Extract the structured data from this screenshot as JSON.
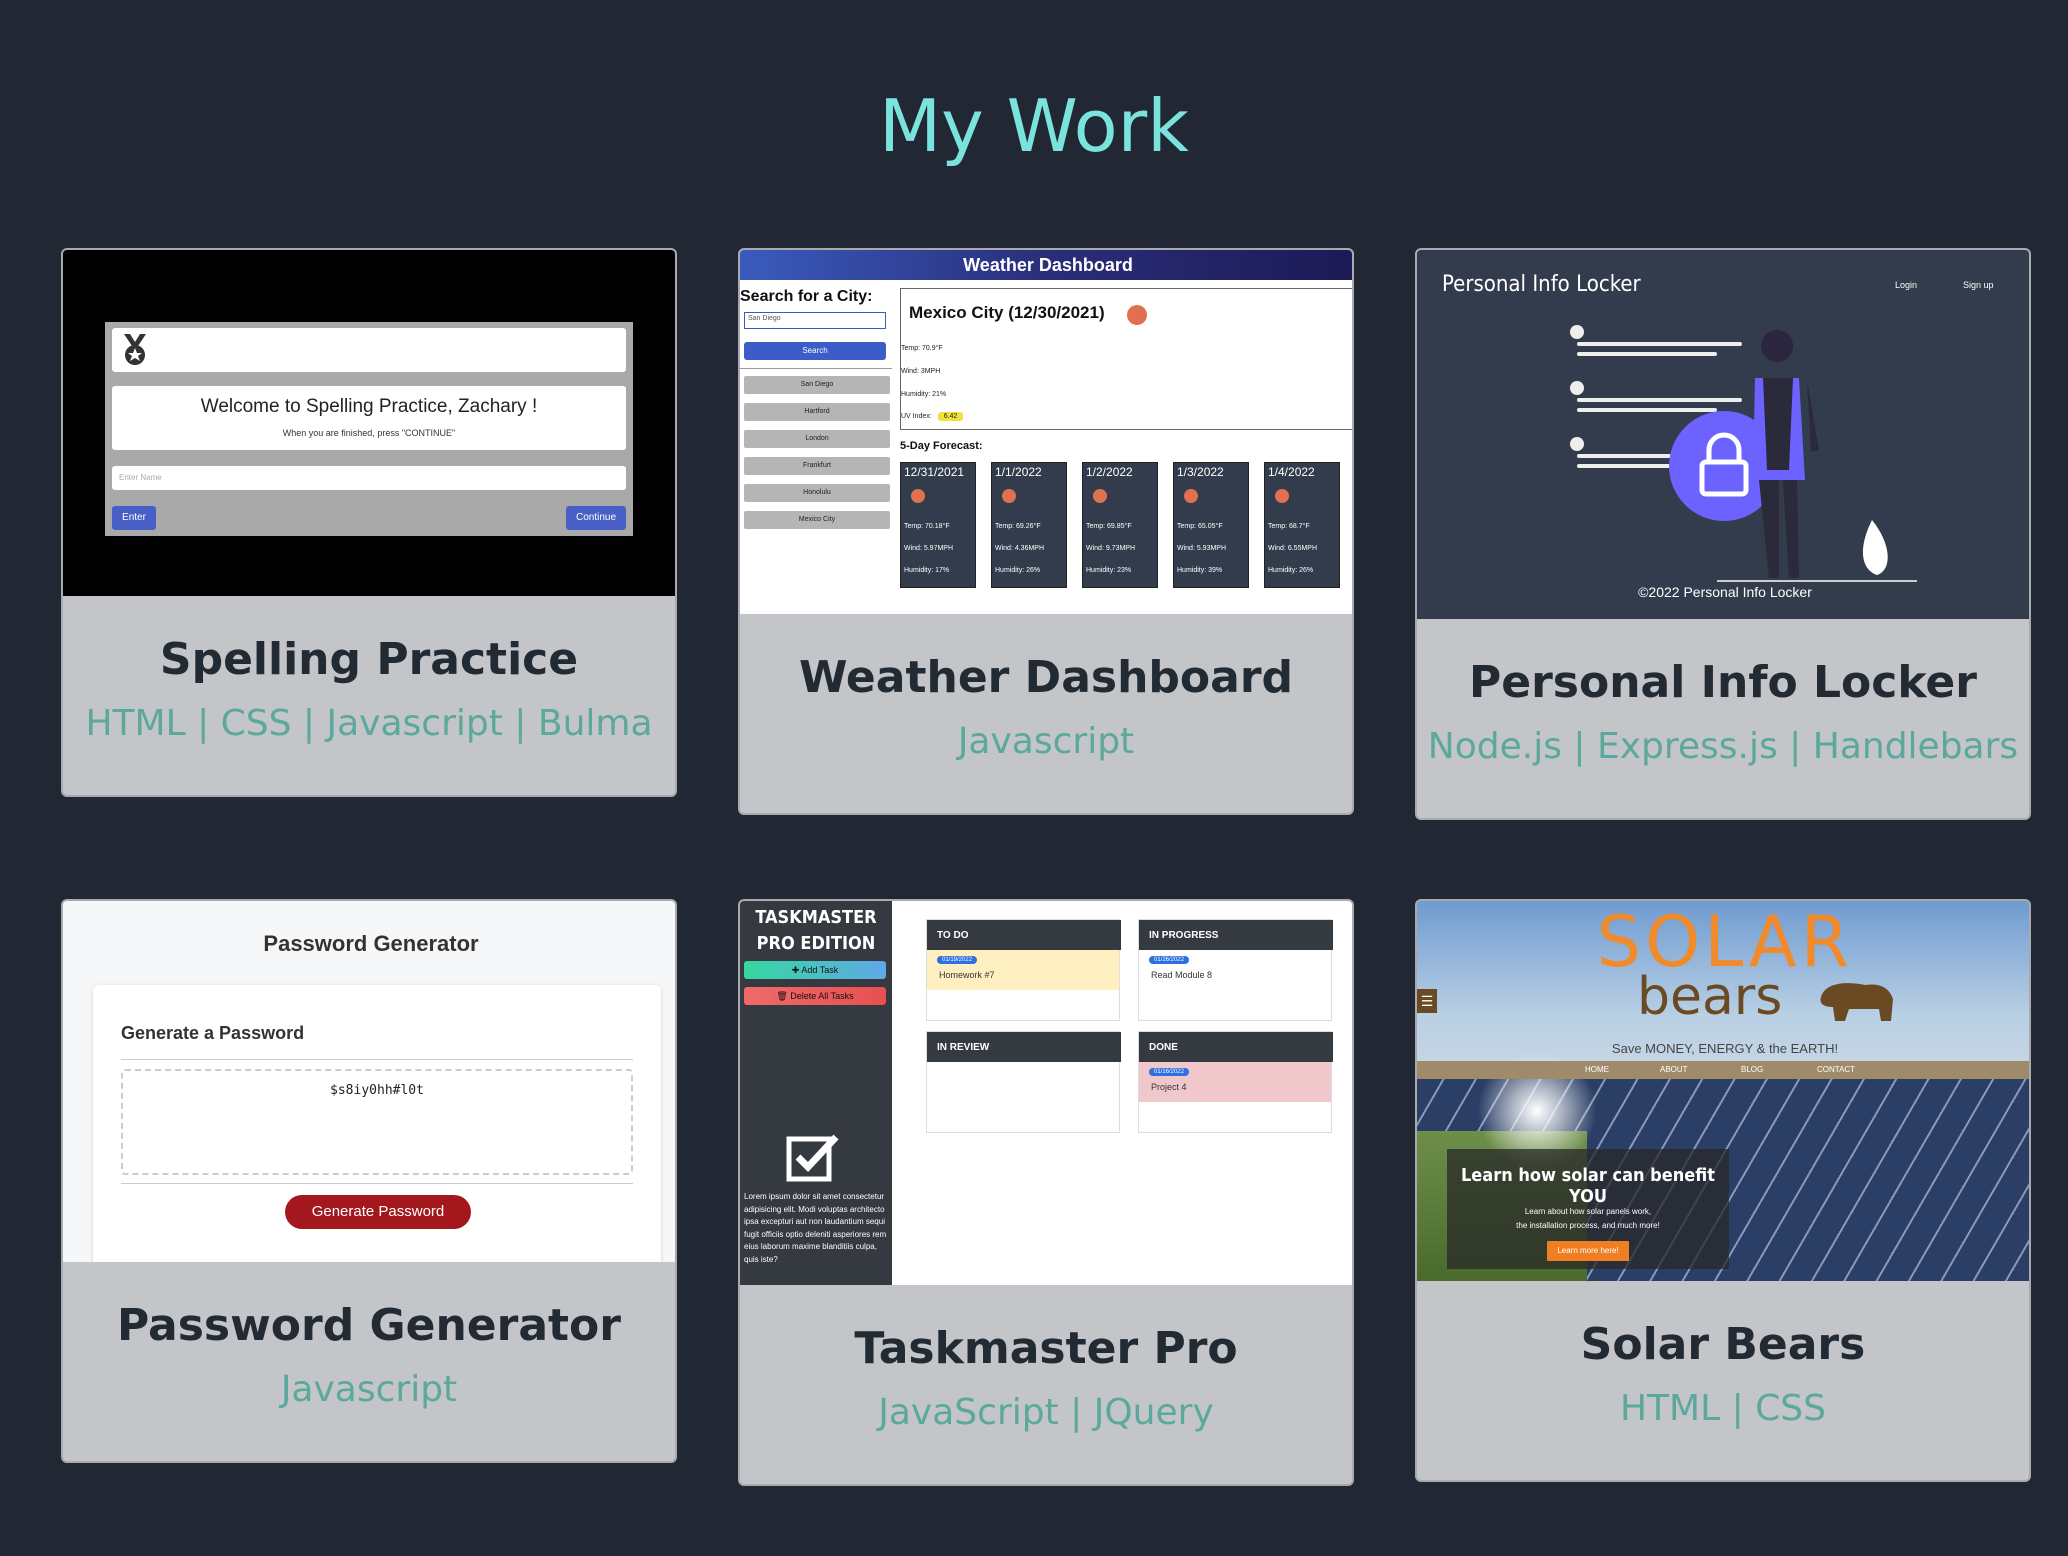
{
  "page": {
    "title": "My Work"
  },
  "projects": [
    {
      "title": "Spelling Practice",
      "tech": "HTML | CSS | Javascript | Bulma",
      "preview": {
        "welcome": "Welcome to Spelling Practice, Zachary !",
        "hint": "When you are finished, press \"CONTINUE\"",
        "placeholder": "Enter Name",
        "enter": "Enter",
        "continue": "Continue",
        "icon": "medal-icon"
      }
    },
    {
      "title": "Weather Dashboard",
      "tech": "Javascript",
      "preview": {
        "header": "Weather Dashboard",
        "search_label": "Search for a City:",
        "search_value": "San Diego",
        "search_button": "Search",
        "history": [
          "San Diego",
          "Hartford",
          "London",
          "Frankfurt",
          "Honolulu",
          "Mexico City"
        ],
        "city_title": "Mexico City (12/30/2021)",
        "temp": "Temp: 70.9°F",
        "wind": "Wind: 3MPH",
        "humidity": "Humidity: 21%",
        "uv_label": "UV Index:",
        "uv_value": "6.42",
        "forecast_label": "5-Day Forecast:",
        "forecast": [
          {
            "date": "12/31/2021",
            "temp": "Temp: 70.18°F",
            "wind": "Wind: 5.97MPH",
            "humidity": "Humidity: 17%"
          },
          {
            "date": "1/1/2022",
            "temp": "Temp: 69.26°F",
            "wind": "Wind: 4.36MPH",
            "humidity": "Humidity: 26%"
          },
          {
            "date": "1/2/2022",
            "temp": "Temp: 69.85°F",
            "wind": "Wind: 9.73MPH",
            "humidity": "Humidity: 23%"
          },
          {
            "date": "1/3/2022",
            "temp": "Temp: 65.05°F",
            "wind": "Wind: 5.93MPH",
            "humidity": "Humidity: 39%"
          },
          {
            "date": "1/4/2022",
            "temp": "Temp: 68.7°F",
            "wind": "Wind: 6.55MPH",
            "humidity": "Humidity: 26%"
          }
        ]
      }
    },
    {
      "title": "Personal Info Locker",
      "tech": "Node.js | Express.js | Handlebars",
      "preview": {
        "brand": "Personal Info Locker",
        "login": "Login",
        "signup": "Sign up",
        "footer": "©2022 Personal Info Locker",
        "icon": "lock-icon"
      }
    },
    {
      "title": "Password Generator",
      "tech": "Javascript",
      "preview": {
        "header": "Password Generator",
        "subheader": "Generate a Password",
        "password": "$s8iy0hh#l0t",
        "button": "Generate Password"
      }
    },
    {
      "title": "Taskmaster Pro",
      "tech": "JavaScript | JQuery",
      "preview": {
        "brand": "TASKMASTER PRO EDITION",
        "add_task": "Add Task",
        "delete_all": "Delete All Tasks",
        "lorem": "Lorem ipsum dolor sit amet consectetur adipisicing elit. Modi voluptas architecto ipsa excepturi aut non laudantium sequi fugit officiis optio deleniti asperiores rem eius laborum maxime blanditiis culpa, quis iste?",
        "columns": [
          {
            "title": "TO DO",
            "date": "01/19/2022",
            "task": "Homework #7"
          },
          {
            "title": "IN PROGRESS",
            "date": "01/26/2022",
            "task": "Read Module 8"
          },
          {
            "title": "IN REVIEW",
            "date": "",
            "task": ""
          },
          {
            "title": "DONE",
            "date": "01/16/2022",
            "task": "Project 4"
          }
        ]
      }
    },
    {
      "title": "Solar Bears",
      "tech": "HTML | CSS",
      "preview": {
        "logo_top": "SOLAR",
        "logo_bottom": "bears",
        "tagline": "Save MONEY, ENERGY & the EARTH!",
        "nav": [
          "HOME",
          "ABOUT",
          "BLOG",
          "CONTACT"
        ],
        "hero_title": "Learn how solar can benefit YOU",
        "hero_text_1": "Learn about how solar panels work,",
        "hero_text_2": "the installation process, and much more!",
        "hero_button": "Learn more here!"
      }
    }
  ],
  "colors": {
    "background": "#212733",
    "title": "#7ae3dd",
    "card": "#c4c5c8",
    "tech": "#5ba89c"
  }
}
